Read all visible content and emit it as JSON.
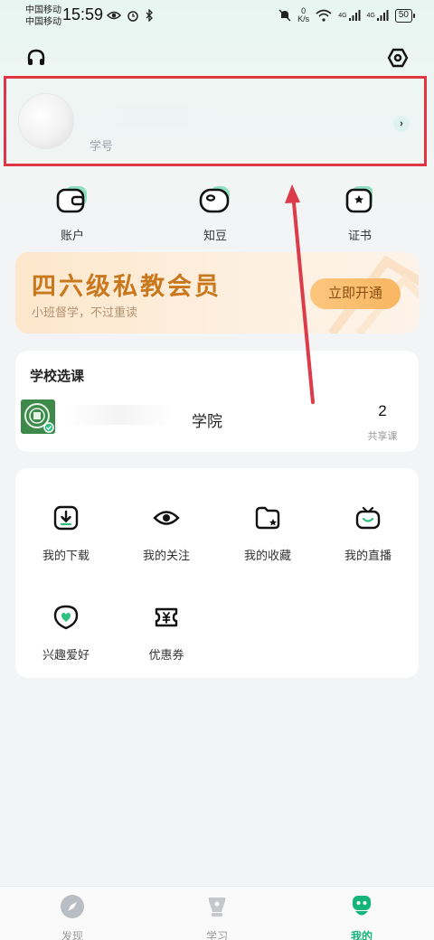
{
  "status_bar": {
    "carrier_1": "中国移动",
    "carrier_2": "中国移动",
    "time": "15:59",
    "speed_value": "0",
    "speed_unit": "K/s",
    "net_1": "4G",
    "net_2": "4G",
    "battery": "50"
  },
  "profile": {
    "student_id_label": "学号"
  },
  "quick_actions": [
    {
      "label": "账户",
      "icon": "wallet-icon"
    },
    {
      "label": "知豆",
      "icon": "bean-icon"
    },
    {
      "label": "证书",
      "icon": "certificate-icon"
    }
  ],
  "vip_banner": {
    "title": "四六级私教会员",
    "subtitle": "小班督学，不过重读",
    "button": "立即开通"
  },
  "school": {
    "section_title": "学校选课",
    "name_suffix": "学院",
    "share_count": "2",
    "share_label": "共享课"
  },
  "features": [
    {
      "label": "我的下载",
      "icon": "download-icon"
    },
    {
      "label": "我的关注",
      "icon": "eye-icon"
    },
    {
      "label": "我的收藏",
      "icon": "folder-star-icon"
    },
    {
      "label": "我的直播",
      "icon": "tv-icon"
    },
    {
      "label": "兴趣爱好",
      "icon": "heart-icon"
    },
    {
      "label": "优惠券",
      "icon": "coupon-icon"
    }
  ],
  "tabbar": [
    {
      "label": "发现",
      "icon": "compass-icon",
      "active": false
    },
    {
      "label": "学习",
      "icon": "pen-icon",
      "active": false
    },
    {
      "label": "我的",
      "icon": "robot-icon",
      "active": true
    }
  ],
  "colors": {
    "accent": "#14b47a",
    "highlight_box": "#e03545",
    "vip_title": "#c9781d"
  }
}
